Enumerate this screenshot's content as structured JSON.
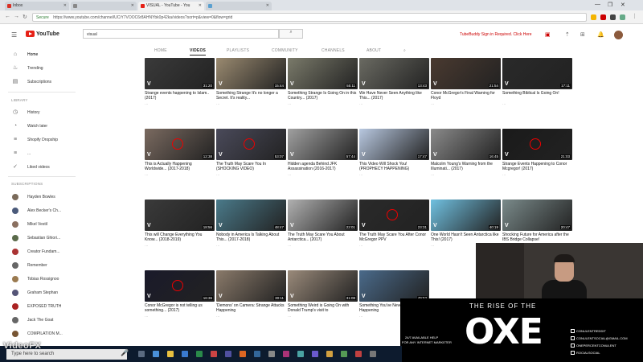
{
  "browser": {
    "tabs": [
      {
        "label": "Inbox",
        "active": false
      },
      {
        "label": "",
        "active": false
      },
      {
        "label": "VISUAL - YouTube - You",
        "active": true
      },
      {
        "label": "",
        "active": false
      }
    ],
    "secure_label": "Secure",
    "url": "https://www.youtube.com/channel/UCiY7VOOC6r8AHNYbk0p42ka/videos?sort=p&view=0&flow=grid"
  },
  "masthead": {
    "logo_text": "YouTube",
    "search_value": "visual",
    "promo_text": "TubeBuddy Sign in Required. Click Here"
  },
  "sidebar": {
    "nav": [
      {
        "label": "Home",
        "icon": "home-icon",
        "glyph": "⌂"
      },
      {
        "label": "Trending",
        "icon": "flame-icon",
        "glyph": "🔥"
      },
      {
        "label": "Subscriptions",
        "icon": "subscriptions-icon",
        "glyph": "▤"
      }
    ],
    "library_heading": "LIBRARY",
    "library": [
      {
        "label": "History",
        "icon": "history-icon",
        "glyph": "◷"
      },
      {
        "label": "Watch later",
        "icon": "clock-icon",
        "glyph": "◔"
      },
      {
        "label": "Shopify Dropship",
        "icon": "playlist-icon",
        "glyph": "≡"
      },
      {
        "label": "...",
        "icon": "playlist-icon",
        "glyph": "≡"
      },
      {
        "label": "Liked videos",
        "icon": "thumbs-up-icon",
        "glyph": "👍"
      }
    ],
    "subscriptions_heading": "SUBSCRIPTIONS",
    "subscriptions": [
      {
        "label": "Hayden Bowles",
        "color": "#7a6a5a"
      },
      {
        "label": "Alex Becker's Ch...",
        "color": "#4a5a7a"
      },
      {
        "label": "Mikel Vestil",
        "color": "#8a7060"
      },
      {
        "label": "Sebastian Ghiori...",
        "color": "#5a6a4a"
      },
      {
        "label": "Creator Fundam...",
        "color": "#aa3333"
      },
      {
        "label": "Remember",
        "color": "#666666"
      },
      {
        "label": "Tobias Rossignoo",
        "color": "#9a7a50"
      },
      {
        "label": "Graham Stephan",
        "color": "#555577"
      },
      {
        "label": "EXPOSED TRUTH",
        "color": "#aa2222"
      },
      {
        "label": "Jack The Goat",
        "color": "#666666"
      },
      {
        "label": "COMPILATION M...",
        "color": "#775533"
      }
    ]
  },
  "channel_tabs": [
    "HOME",
    "VIDEOS",
    "PLAYLISTS",
    "COMMUNITY",
    "CHANNELS",
    "ABOUT"
  ],
  "videos": [
    {
      "title": "Strange events happening to Islam.. (2017)",
      "meta": "…",
      "duration": "31:20",
      "bg": "#3a3a3a"
    },
    {
      "title": "Something Strange It's no longer a Secret. It's reality...",
      "meta": "…",
      "duration": "15:44",
      "bg": "#9a8a70"
    },
    {
      "title": "Something Strange Is Going On in this Country... (2017)",
      "meta": "…",
      "duration": "55:11",
      "bg": "#7a7a6a"
    },
    {
      "title": "We Have Never Seen Anything like This... (2017)",
      "meta": "…",
      "duration": "13:43",
      "bg": "#6a6a62"
    },
    {
      "title": "Conor McGregor's Final Warning for Floyd",
      "meta": "…",
      "duration": "21:54",
      "bg": "#4a3a30"
    },
    {
      "title": "Something Biblical Is Going On!",
      "meta": "…",
      "duration": "17:11",
      "bg": "#2a2a2a"
    },
    {
      "title": "This is Actually Happening Worldwide... (2017-2018)",
      "meta": "…",
      "duration": "12:38",
      "bg": "#7a6a60"
    },
    {
      "title": "The Truth May Scare You In (SHOCKING VIDEO)",
      "meta": "…",
      "duration": "53:07",
      "bg": "#4a4a5a"
    },
    {
      "title": "Hidden agenda Behind JFK Assassination (2016-2017)",
      "meta": "…",
      "duration": "57:44",
      "bg": "#a0a0a0"
    },
    {
      "title": "This Video Will Shock You! (PROPHECY HAPPENING)",
      "meta": "…",
      "duration": "17:47",
      "bg": "#b8c8e0"
    },
    {
      "title": "Malcolm Young's Warning from the Illuminati... (2017)",
      "meta": "…",
      "duration": "16:45",
      "bg": "#8a8a8a"
    },
    {
      "title": "Strange Events Happening to Conor Mcgregor! (2017)",
      "meta": "…",
      "duration": "21:03",
      "bg": "#1a1a1a"
    },
    {
      "title": "This will Change Everything You Know... (2018-2019)",
      "meta": "…",
      "duration": "18:56",
      "bg": "#3a3a3a"
    },
    {
      "title": "Nobody in America Is Talking About This... (2017-2018)",
      "meta": "…",
      "duration": "48:47",
      "bg": "#4a7a8a"
    },
    {
      "title": "The Truth May Scare You About Antarctica... (2017)",
      "meta": "…",
      "duration": "22:01",
      "bg": "#b0b0b0"
    },
    {
      "title": "The Truth May Scare You After Conor McGregor PPV",
      "meta": "…",
      "duration": "23:31",
      "bg": "#2a2a2a"
    },
    {
      "title": "One World Hasn't Seen Antarctica like This! (2017)",
      "meta": "…",
      "duration": "40:19",
      "bg": "#70c0e0"
    },
    {
      "title": "Shocking Future for America after the IBS Bridge Collapse!",
      "meta": "…",
      "duration": "20:47",
      "bg": "#7a8a8a"
    },
    {
      "title": "Conor McGregor is not telling us something... (2017)",
      "meta": "…",
      "duration": "16:36",
      "bg": "#1a1a2a"
    },
    {
      "title": "'Demons' on Camera: Strange Attacks Happening",
      "meta": "…",
      "duration": "30:11",
      "bg": "#8a7a6a"
    },
    {
      "title": "Something Weird is Going On with Donald Trump's visit to",
      "meta": "…",
      "duration": "31:08",
      "bg": "#9a8a7a"
    },
    {
      "title": "Something You've Never Seen Is Happening",
      "meta": "…",
      "duration": "49:53",
      "bg": "#4a6a8a"
    }
  ],
  "overlay": {
    "title": "THE RISE OF THE",
    "logo": "OXE",
    "help_line1": "24/7 AVAILABLE HELP",
    "help_line2": "FOR ANY INTERNET MARKETER",
    "contacts": [
      "CONULENTREDDIT",
      "CONULENTSOCIAL@GMAIL.COM",
      "ONEPERCENTCONULENT",
      "ROCIALSOCIAL"
    ]
  },
  "taskbar": {
    "search_placeholder": "Type here to search"
  },
  "watermark": "VideoFX"
}
